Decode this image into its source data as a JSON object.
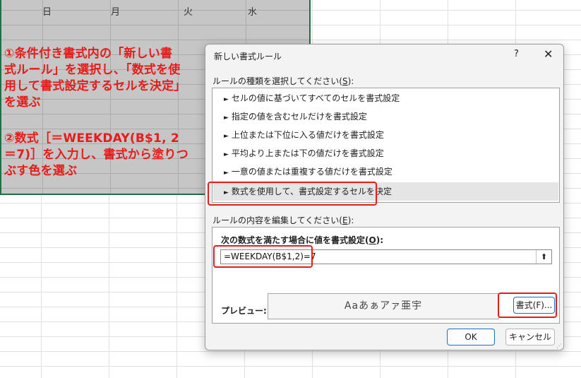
{
  "sheet": {
    "day_headers": [
      "日",
      "月",
      "火",
      "水"
    ]
  },
  "annotations": {
    "step1": "①条件付き書式内の「新しい書\n式ルール」を選択し、「数式を使\n用して書式設定するセルを決定」\nを選ぶ",
    "step2": "②数式［＝WEEKDAY(B$1, 2\n＝7)］を入力し、書式から塗りつ\nぶす色を選ぶ"
  },
  "dialog": {
    "title": "新しい書式ルール",
    "help": "?",
    "close": "✕",
    "rule_type_label": "ルールの種類を選択してください(",
    "rule_type_key": "S",
    "rule_type_end": "):",
    "rule_types": [
      "セルの値に基づいてすべてのセルを書式設定",
      "指定の値を含むセルだけを書式設定",
      "上位または下位に入る値だけを書式設定",
      "平均より上または下の値だけを書式設定",
      "一意の値または重複する値だけを書式設定",
      "数式を使用して、書式設定するセルを決定"
    ],
    "rule_arrow": "►",
    "edit_label": "ルールの内容を編集してください(",
    "edit_key": "E",
    "edit_end": "):",
    "formula_label": "次の数式を満たす場合に値を書式設定(",
    "formula_key": "O",
    "formula_end": "):",
    "formula_value": "=WEEKDAY(B$1,2)=7",
    "collapse_icon": "⬆",
    "preview_label": "プレビュー:",
    "preview_text": "Aaあぁアァ亜宇",
    "format_button": "書式(F)...",
    "ok_button": "OK",
    "cancel_button": "キャンセル"
  },
  "colors": {
    "annotation_red": "#e81b1b",
    "selection_border": "#1e7145"
  }
}
